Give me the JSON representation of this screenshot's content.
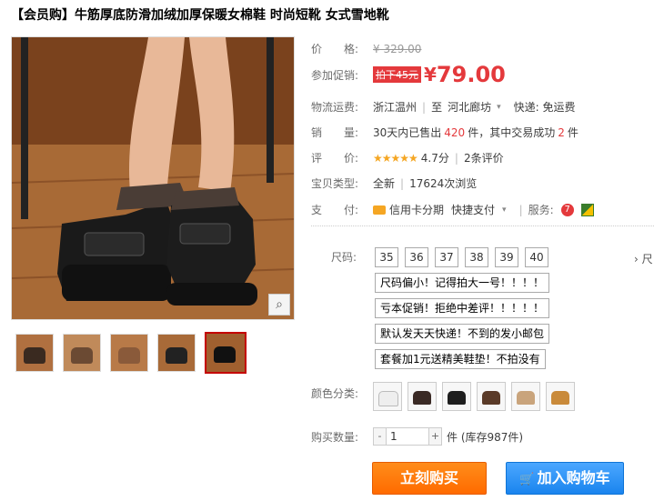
{
  "title": "【会员购】牛筋厚底防滑加绒加厚保暖女棉鞋 时尚短靴 女式雪地靴",
  "price": {
    "label": "价　　格:",
    "original": "¥ 329.00"
  },
  "promo": {
    "label": "参加促销:",
    "tag": "拍下45元",
    "yen": "¥",
    "value": "79.00"
  },
  "shipping": {
    "label": "物流运费:",
    "from": "浙江温州",
    "to_prefix": "至",
    "to": "河北廊坊",
    "fee": "快递: 免运费"
  },
  "sales": {
    "label": "销　　量:",
    "text_prefix": "30天内已售出",
    "count": "420",
    "text_mid": "件，其中交易成功",
    "success": "2",
    "text_suffix": "件"
  },
  "rating": {
    "label": "评　　价:",
    "stars": "★★★★★",
    "score": "4.7分",
    "reviews": "2条评价"
  },
  "item_type": {
    "label": "宝贝类型:",
    "condition": "全新",
    "views": "17624次浏览"
  },
  "payment": {
    "label": "支　　付:",
    "method1": "信用卡分期",
    "method2": "快捷支付",
    "service_label": "服务:",
    "icon1": "tmall-icon",
    "icon2": "guarantee-icon"
  },
  "size": {
    "label": "尺码:",
    "options": [
      "35",
      "36",
      "37",
      "38",
      "39",
      "40"
    ],
    "truncated": "› 尺"
  },
  "notes": [
    "尺码偏小！记得拍大一号！！！！",
    "亏本促销！拒绝中差评！！！！！",
    "默认发天天快递！不到的发小邮包",
    "套餐加1元送精美鞋垫！不拍没有"
  ],
  "color": {
    "label": "颜色分类:"
  },
  "quantity": {
    "label": "购买数量:",
    "value": "1",
    "minus": "-",
    "plus": "+",
    "stock": "件 (库存987件)"
  },
  "buttons": {
    "buy": "立刻购买",
    "cart": "加入购物车"
  },
  "colors": {
    "accent": "#e4393c",
    "buy": "#ff6b00",
    "cart": "#1a84ee"
  }
}
